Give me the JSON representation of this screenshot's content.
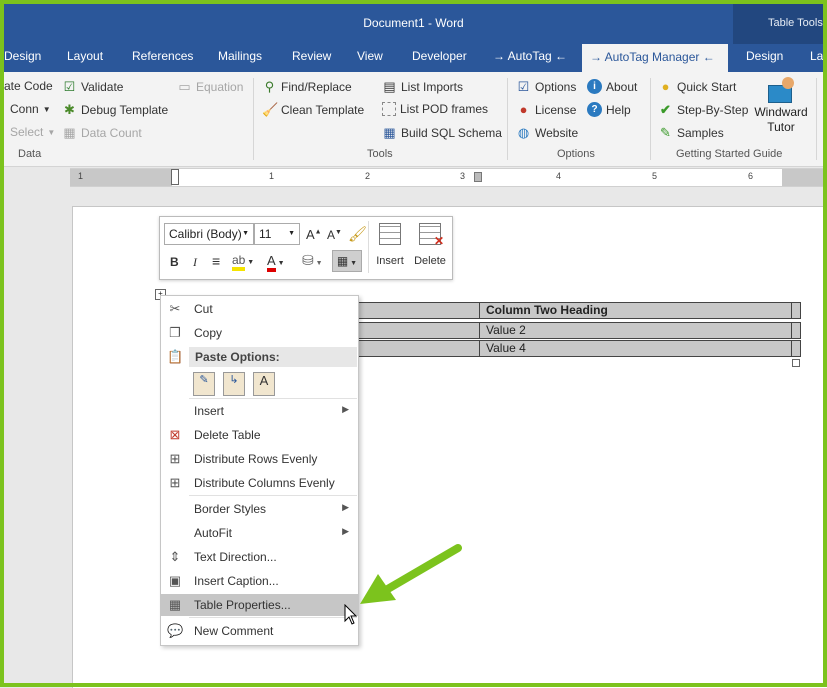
{
  "window": {
    "title": "Document1  -  Word",
    "context_tab_group": "Table Tools"
  },
  "tabs": [
    {
      "label": "Design"
    },
    {
      "label": "Layout"
    },
    {
      "label": "References"
    },
    {
      "label": "Mailings"
    },
    {
      "label": "Review"
    },
    {
      "label": "View"
    },
    {
      "label": "Developer"
    },
    {
      "label": "→ AutoTag ←"
    },
    {
      "label": "→ AutoTag Manager ←"
    },
    {
      "label": "Design"
    },
    {
      "label": "La"
    }
  ],
  "ribbon": {
    "data_group": {
      "label": "Data",
      "items": [
        {
          "label": "ate Code"
        },
        {
          "label": "Conn"
        },
        {
          "label": "Select"
        },
        {
          "label": "Validate"
        },
        {
          "label": "Debug Template"
        },
        {
          "label": "Data Count"
        },
        {
          "label": "Equation"
        }
      ]
    },
    "tools_group": {
      "label": "Tools",
      "items": [
        {
          "label": "Find/Replace"
        },
        {
          "label": "Clean Template"
        },
        {
          "label": "List Imports"
        },
        {
          "label": "List POD frames"
        },
        {
          "label": "Build SQL Schema"
        }
      ]
    },
    "options_group": {
      "label": "Options",
      "items": [
        {
          "label": "Options"
        },
        {
          "label": "License"
        },
        {
          "label": "Website"
        },
        {
          "label": "About"
        },
        {
          "label": "Help"
        }
      ]
    },
    "getting_started_group": {
      "label": "Getting Started Guide",
      "items": [
        {
          "label": "Quick Start"
        },
        {
          "label": "Step-By-Step"
        },
        {
          "label": "Samples"
        }
      ],
      "big_button": {
        "line1": "Windward",
        "line2": "Tutor"
      }
    }
  },
  "ruler": {
    "numbers": [
      "1",
      "1",
      "2",
      "3",
      "4",
      "5",
      "6"
    ]
  },
  "mini_toolbar": {
    "font": "Calibri (Body)",
    "size": "11",
    "insert_label": "Insert",
    "delete_label": "Delete",
    "bold": "B",
    "italic": "I"
  },
  "table": {
    "heading": "Column Two Heading",
    "values": [
      "Value 2",
      "Value 4"
    ]
  },
  "context_menu": {
    "items": [
      {
        "label": "Cut"
      },
      {
        "label": "Copy"
      },
      {
        "label": "Paste Options:"
      },
      {
        "label": "Insert"
      },
      {
        "label": "Delete Table"
      },
      {
        "label": "Distribute Rows Evenly"
      },
      {
        "label": "Distribute Columns Evenly"
      },
      {
        "label": "Border Styles"
      },
      {
        "label": "AutoFit"
      },
      {
        "label": "Text Direction..."
      },
      {
        "label": "Insert Caption..."
      },
      {
        "label": "Table Properties..."
      },
      {
        "label": "New Comment"
      }
    ],
    "highlighted": "Table Properties...",
    "accent_color": "#7cc31d"
  }
}
